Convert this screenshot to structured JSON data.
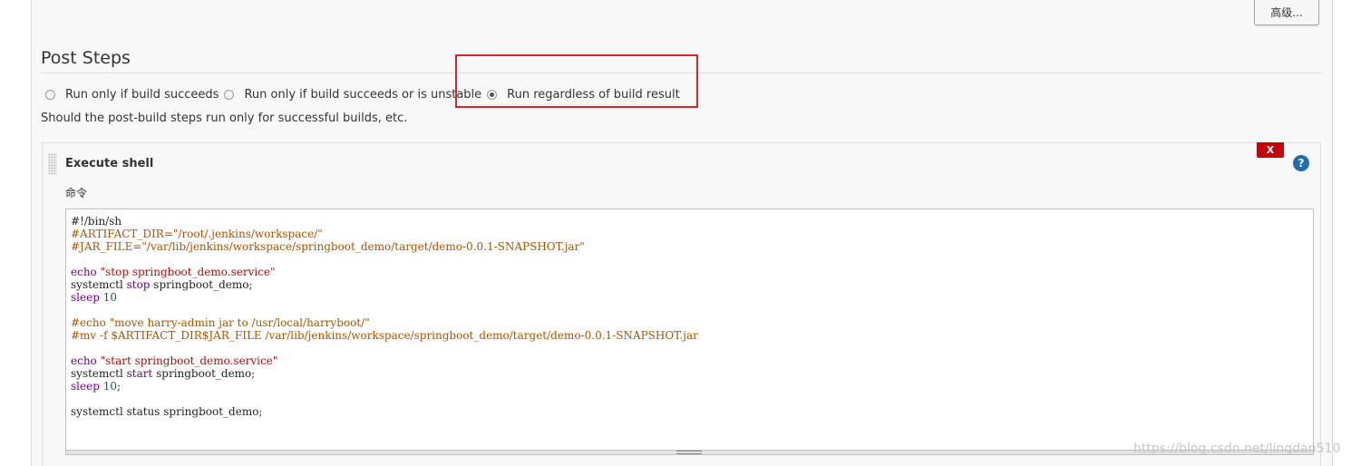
{
  "header": {
    "advanced_button_label": "高级..."
  },
  "post_steps": {
    "title": "Post Steps",
    "options": [
      {
        "label": "Run only if build succeeds",
        "selected": false
      },
      {
        "label": "Run only if build succeeds or is unstable",
        "selected": false
      },
      {
        "label": "Run regardless of build result",
        "selected": true
      }
    ],
    "help_text": "Should the post-build steps run only for successful builds, etc."
  },
  "step": {
    "title": "Execute shell",
    "delete_label": "X",
    "help_icon_label": "?",
    "command_label": "命令",
    "lines": [
      "#!/bin/sh",
      "#ARTIFACT_DIR=\"/root/.jenkins/workspace/\"",
      "#JAR_FILE=\"/var/lib/jenkins/workspace/springboot_demo/target/demo-0.0.1-SNAPSHOT.jar\"",
      "",
      "echo \"stop springboot_demo.service\"",
      "systemctl stop springboot_demo;",
      "sleep 10",
      "",
      "#echo \"move harry-admin jar to /usr/local/harryboot/\"",
      "#mv -f $ARTIFACT_DIR$JAR_FILE /var/lib/jenkins/workspace/springboot_demo/target/demo-0.0.1-SNAPSHOT.jar",
      "",
      "echo \"start springboot_demo.service\"",
      "systemctl start springboot_demo;",
      "sleep 10;",
      "",
      "systemctl status springboot_demo;"
    ]
  },
  "watermark": "https://blog.csdn.net/lingdan510",
  "colors": {
    "highlight_box": "#d9232e",
    "delete_button": "#c4000a",
    "help_icon": "#1f6cb0"
  }
}
